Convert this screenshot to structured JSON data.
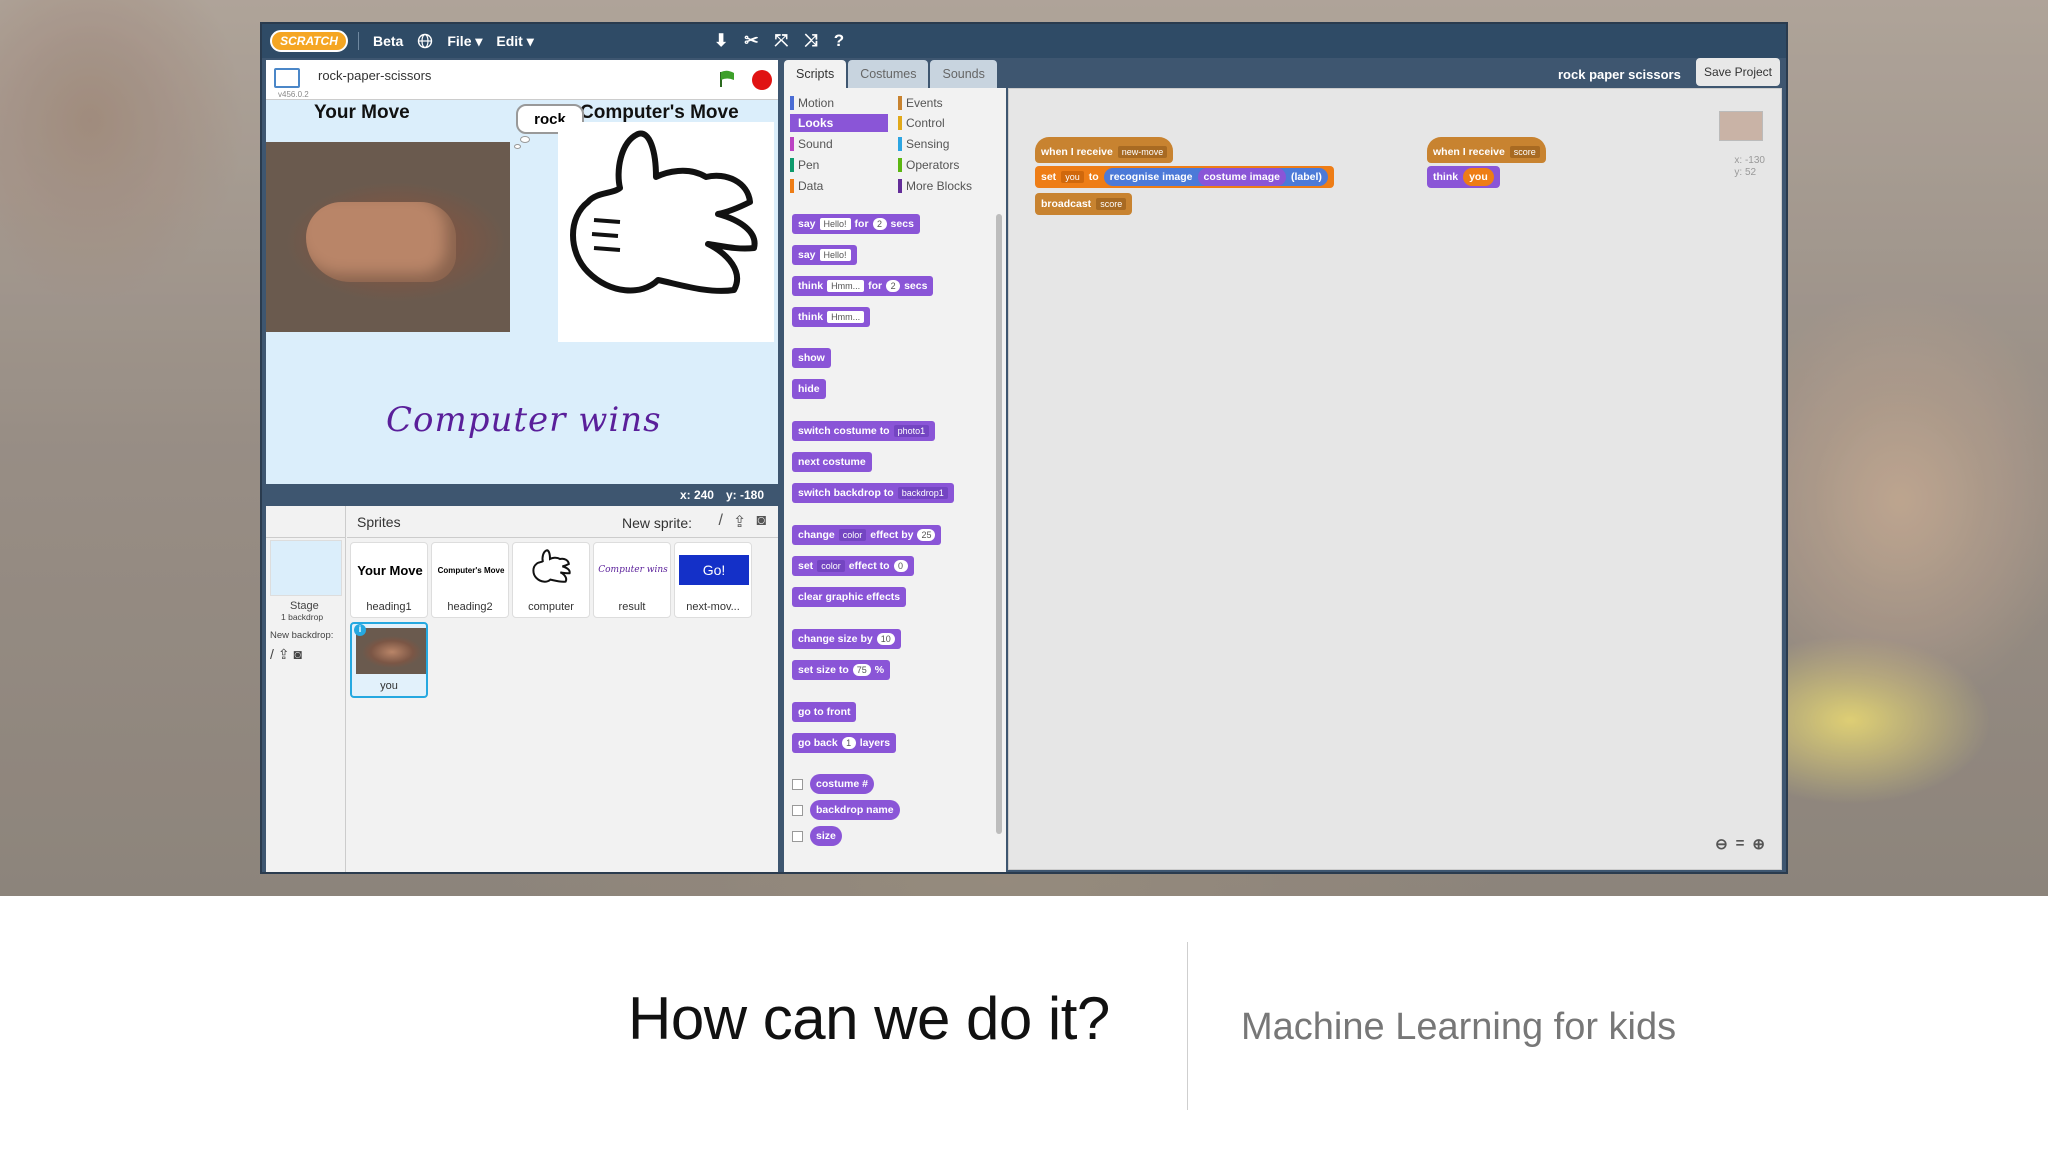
{
  "menubar": {
    "logo_text": "SCRATCH",
    "beta_label": "Beta",
    "file_label": "File ▾",
    "edit_label": "Edit ▾"
  },
  "stage_header": {
    "project_name": "rock-paper-scissors",
    "version": "v456.0.2"
  },
  "stage": {
    "your_move_heading": "Your Move",
    "computer_move_heading": "Computer's Move",
    "speech_bubble": "rock",
    "result_text": "Computer wins",
    "coords_x": "x: 240",
    "coords_y": "y: -180"
  },
  "sprites_pane": {
    "title": "Sprites",
    "new_sprite_label": "New sprite:",
    "stage_label": "Stage",
    "stage_backdrops": "1 backdrop",
    "new_backdrop_label": "New backdrop:",
    "tiles": [
      {
        "label": "heading1",
        "thumb_text": "Your Move"
      },
      {
        "label": "heading2",
        "thumb_text": "Computer's Move"
      },
      {
        "label": "computer",
        "thumb_text": ""
      },
      {
        "label": "result",
        "thumb_text": "Computer wins"
      },
      {
        "label": "next-mov...",
        "thumb_text": "Go!"
      },
      {
        "label": "you",
        "thumb_text": ""
      }
    ]
  },
  "tabs": [
    "Scripts",
    "Costumes",
    "Sounds"
  ],
  "project_title": "rock paper scissors",
  "save_button": "Save Project",
  "categories": [
    {
      "name": "Motion",
      "color": "#4a6cd4"
    },
    {
      "name": "Looks",
      "color": "#8a55d7"
    },
    {
      "name": "Sound",
      "color": "#bb42c3"
    },
    {
      "name": "Pen",
      "color": "#0e9a6c"
    },
    {
      "name": "Data",
      "color": "#ee7d16"
    },
    {
      "name": "Events",
      "color": "#c88330"
    },
    {
      "name": "Control",
      "color": "#e1a91a"
    },
    {
      "name": "Sensing",
      "color": "#2ca5e2"
    },
    {
      "name": "Operators",
      "color": "#5cb712"
    },
    {
      "name": "More Blocks",
      "color": "#632d99"
    }
  ],
  "palette": {
    "say_for": {
      "a": "say",
      "b": "Hello!",
      "c": "for",
      "d": "2",
      "e": "secs"
    },
    "say": {
      "a": "say",
      "b": "Hello!"
    },
    "think_for": {
      "a": "think",
      "b": "Hmm...",
      "c": "for",
      "d": "2",
      "e": "secs"
    },
    "think": {
      "a": "think",
      "b": "Hmm..."
    },
    "show": "show",
    "hide": "hide",
    "switch_costume": {
      "a": "switch costume to",
      "b": "photo1"
    },
    "next_costume": "next costume",
    "switch_backdrop": {
      "a": "switch backdrop to",
      "b": "backdrop1"
    },
    "change_effect": {
      "a": "change",
      "b": "color",
      "c": "effect by",
      "d": "25"
    },
    "set_effect": {
      "a": "set",
      "b": "color",
      "c": "effect to",
      "d": "0"
    },
    "clear_effects": "clear graphic effects",
    "change_size": {
      "a": "change size by",
      "b": "10"
    },
    "set_size": {
      "a": "set size to",
      "b": "75",
      "c": "%"
    },
    "go_front": "go to front",
    "go_back": {
      "a": "go back",
      "b": "1",
      "c": "layers"
    },
    "costume_rep": "costume #",
    "backdrop_rep": "backdrop name",
    "size_rep": "size"
  },
  "script1": {
    "hat": {
      "a": "when I receive",
      "b": "new-move"
    },
    "set": {
      "a": "set",
      "b": "you",
      "c": "to",
      "d": "recognise image",
      "e": "costume image",
      "f": "(label)"
    },
    "broadcast": {
      "a": "broadcast",
      "b": "score"
    }
  },
  "script2": {
    "hat": {
      "a": "when I receive",
      "b": "score"
    },
    "think": {
      "a": "think",
      "b": "you"
    }
  },
  "canvas": {
    "x": "x: -130",
    "y": "y: 52"
  },
  "caption": {
    "main": "How can we do it?",
    "sub": "Machine Learning for kids"
  }
}
